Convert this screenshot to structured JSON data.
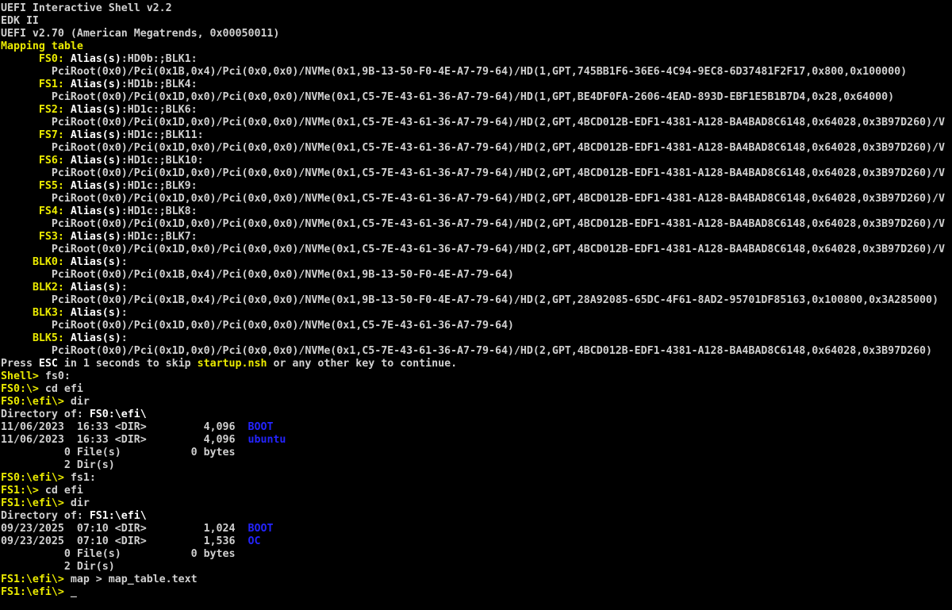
{
  "colors": {
    "background": "#000000",
    "gray": "#d0d0d0",
    "white": "#ffffff",
    "yellow": "#ebeb00",
    "blue": "#2424ff"
  },
  "terminal": {
    "lines": [
      {
        "name": "shell-version-line",
        "segments": [
          {
            "color": "gray",
            "text": "UEFI Interactive Shell v2.2"
          }
        ]
      },
      {
        "name": "edk-version-line",
        "segments": [
          {
            "color": "gray",
            "text": "EDK II"
          }
        ]
      },
      {
        "name": "firmware-version-line",
        "segments": [
          {
            "color": "gray",
            "text": "UEFI v2.70 (American Megatrends, 0x00050011)"
          }
        ]
      },
      {
        "name": "mapping-table-header",
        "segments": [
          {
            "color": "yellow",
            "text": "Mapping table"
          }
        ]
      },
      {
        "name": "map-entry-fs0",
        "segments": [
          {
            "color": "gray",
            "text": "      "
          },
          {
            "color": "yellow",
            "text": "FS0:"
          },
          {
            "color": "gray",
            "text": " "
          },
          {
            "color": "white",
            "text": "Alias(s)"
          },
          {
            "color": "gray",
            "text": ":HD0b:;BLK1:"
          }
        ]
      },
      {
        "name": "device-path-fs0",
        "segments": [
          {
            "color": "gray",
            "text": "        PciRoot(0x0)/Pci(0x1B,0x4)/Pci(0x0,0x0)/NVMe(0x1,9B-13-50-F0-4E-A7-79-64)/HD(1,GPT,745BB1F6-36E6-4C94-9EC8-6D37481F2F17,0x800,0x100000)"
          }
        ]
      },
      {
        "name": "map-entry-fs1",
        "segments": [
          {
            "color": "gray",
            "text": "      "
          },
          {
            "color": "yellow",
            "text": "FS1:"
          },
          {
            "color": "gray",
            "text": " "
          },
          {
            "color": "white",
            "text": "Alias(s)"
          },
          {
            "color": "gray",
            "text": ":HD1b:;BLK4:"
          }
        ]
      },
      {
        "name": "device-path-fs1",
        "segments": [
          {
            "color": "gray",
            "text": "        PciRoot(0x0)/Pci(0x1D,0x0)/Pci(0x0,0x0)/NVMe(0x1,C5-7E-43-61-36-A7-79-64)/HD(1,GPT,BE4DF0FA-2606-4EAD-893D-EBF1E5B1B7D4,0x28,0x64000)"
          }
        ]
      },
      {
        "name": "map-entry-fs2",
        "segments": [
          {
            "color": "gray",
            "text": "      "
          },
          {
            "color": "yellow",
            "text": "FS2:"
          },
          {
            "color": "gray",
            "text": " "
          },
          {
            "color": "white",
            "text": "Alias(s)"
          },
          {
            "color": "gray",
            "text": ":HD1c:;BLK6:"
          }
        ]
      },
      {
        "name": "device-path-fs2",
        "segments": [
          {
            "color": "gray",
            "text": "        PciRoot(0x0)/Pci(0x1D,0x0)/Pci(0x0,0x0)/NVMe(0x1,C5-7E-43-61-36-A7-79-64)/HD(2,GPT,4BCD012B-EDF1-4381-A128-BA4BAD8C6148,0x64028,0x3B97D260)/V"
          }
        ]
      },
      {
        "name": "map-entry-fs7",
        "segments": [
          {
            "color": "gray",
            "text": "      "
          },
          {
            "color": "yellow",
            "text": "FS7:"
          },
          {
            "color": "gray",
            "text": " "
          },
          {
            "color": "white",
            "text": "Alias(s)"
          },
          {
            "color": "gray",
            "text": ":HD1c:;BLK11:"
          }
        ]
      },
      {
        "name": "device-path-fs7",
        "segments": [
          {
            "color": "gray",
            "text": "        PciRoot(0x0)/Pci(0x1D,0x0)/Pci(0x0,0x0)/NVMe(0x1,C5-7E-43-61-36-A7-79-64)/HD(2,GPT,4BCD012B-EDF1-4381-A128-BA4BAD8C6148,0x64028,0x3B97D260)/V"
          }
        ]
      },
      {
        "name": "map-entry-fs6",
        "segments": [
          {
            "color": "gray",
            "text": "      "
          },
          {
            "color": "yellow",
            "text": "FS6:"
          },
          {
            "color": "gray",
            "text": " "
          },
          {
            "color": "white",
            "text": "Alias(s)"
          },
          {
            "color": "gray",
            "text": ":HD1c:;BLK10:"
          }
        ]
      },
      {
        "name": "device-path-fs6",
        "segments": [
          {
            "color": "gray",
            "text": "        PciRoot(0x0)/Pci(0x1D,0x0)/Pci(0x0,0x0)/NVMe(0x1,C5-7E-43-61-36-A7-79-64)/HD(2,GPT,4BCD012B-EDF1-4381-A128-BA4BAD8C6148,0x64028,0x3B97D260)/V"
          }
        ]
      },
      {
        "name": "map-entry-fs5",
        "segments": [
          {
            "color": "gray",
            "text": "      "
          },
          {
            "color": "yellow",
            "text": "FS5:"
          },
          {
            "color": "gray",
            "text": " "
          },
          {
            "color": "white",
            "text": "Alias(s)"
          },
          {
            "color": "gray",
            "text": ":HD1c:;BLK9:"
          }
        ]
      },
      {
        "name": "device-path-fs5",
        "segments": [
          {
            "color": "gray",
            "text": "        PciRoot(0x0)/Pci(0x1D,0x0)/Pci(0x0,0x0)/NVMe(0x1,C5-7E-43-61-36-A7-79-64)/HD(2,GPT,4BCD012B-EDF1-4381-A128-BA4BAD8C6148,0x64028,0x3B97D260)/V"
          }
        ]
      },
      {
        "name": "map-entry-fs4",
        "segments": [
          {
            "color": "gray",
            "text": "      "
          },
          {
            "color": "yellow",
            "text": "FS4:"
          },
          {
            "color": "gray",
            "text": " "
          },
          {
            "color": "white",
            "text": "Alias(s)"
          },
          {
            "color": "gray",
            "text": ":HD1c:;BLK8:"
          }
        ]
      },
      {
        "name": "device-path-fs4",
        "segments": [
          {
            "color": "gray",
            "text": "        PciRoot(0x0)/Pci(0x1D,0x0)/Pci(0x0,0x0)/NVMe(0x1,C5-7E-43-61-36-A7-79-64)/HD(2,GPT,4BCD012B-EDF1-4381-A128-BA4BAD8C6148,0x64028,0x3B97D260)/V"
          }
        ]
      },
      {
        "name": "map-entry-fs3",
        "segments": [
          {
            "color": "gray",
            "text": "      "
          },
          {
            "color": "yellow",
            "text": "FS3:"
          },
          {
            "color": "gray",
            "text": " "
          },
          {
            "color": "white",
            "text": "Alias(s)"
          },
          {
            "color": "gray",
            "text": ":HD1c:;BLK7:"
          }
        ]
      },
      {
        "name": "device-path-fs3",
        "segments": [
          {
            "color": "gray",
            "text": "        PciRoot(0x0)/Pci(0x1D,0x0)/Pci(0x0,0x0)/NVMe(0x1,C5-7E-43-61-36-A7-79-64)/HD(2,GPT,4BCD012B-EDF1-4381-A128-BA4BAD8C6148,0x64028,0x3B97D260)/V"
          }
        ]
      },
      {
        "name": "map-entry-blk0",
        "segments": [
          {
            "color": "gray",
            "text": "     "
          },
          {
            "color": "yellow",
            "text": "BLK0:"
          },
          {
            "color": "gray",
            "text": " "
          },
          {
            "color": "white",
            "text": "Alias(s)"
          },
          {
            "color": "gray",
            "text": ":"
          }
        ]
      },
      {
        "name": "device-path-blk0",
        "segments": [
          {
            "color": "gray",
            "text": "        PciRoot(0x0)/Pci(0x1B,0x4)/Pci(0x0,0x0)/NVMe(0x1,9B-13-50-F0-4E-A7-79-64)"
          }
        ]
      },
      {
        "name": "map-entry-blk2",
        "segments": [
          {
            "color": "gray",
            "text": "     "
          },
          {
            "color": "yellow",
            "text": "BLK2:"
          },
          {
            "color": "gray",
            "text": " "
          },
          {
            "color": "white",
            "text": "Alias(s)"
          },
          {
            "color": "gray",
            "text": ":"
          }
        ]
      },
      {
        "name": "device-path-blk2",
        "segments": [
          {
            "color": "gray",
            "text": "        PciRoot(0x0)/Pci(0x1B,0x4)/Pci(0x0,0x0)/NVMe(0x1,9B-13-50-F0-4E-A7-79-64)/HD(2,GPT,28A92085-65DC-4F61-8AD2-95701DF85163,0x100800,0x3A285000)"
          }
        ]
      },
      {
        "name": "map-entry-blk3",
        "segments": [
          {
            "color": "gray",
            "text": "     "
          },
          {
            "color": "yellow",
            "text": "BLK3:"
          },
          {
            "color": "gray",
            "text": " "
          },
          {
            "color": "white",
            "text": "Alias(s)"
          },
          {
            "color": "gray",
            "text": ":"
          }
        ]
      },
      {
        "name": "device-path-blk3",
        "segments": [
          {
            "color": "gray",
            "text": "        PciRoot(0x0)/Pci(0x1D,0x0)/Pci(0x0,0x0)/NVMe(0x1,C5-7E-43-61-36-A7-79-64)"
          }
        ]
      },
      {
        "name": "map-entry-blk5",
        "segments": [
          {
            "color": "gray",
            "text": "     "
          },
          {
            "color": "yellow",
            "text": "BLK5:"
          },
          {
            "color": "gray",
            "text": " "
          },
          {
            "color": "white",
            "text": "Alias(s)"
          },
          {
            "color": "gray",
            "text": ":"
          }
        ]
      },
      {
        "name": "device-path-blk5",
        "segments": [
          {
            "color": "gray",
            "text": "        PciRoot(0x0)/Pci(0x1D,0x0)/Pci(0x0,0x0)/NVMe(0x1,C5-7E-43-61-36-A7-79-64)/HD(2,GPT,4BCD012B-EDF1-4381-A128-BA4BAD8C6148,0x64028,0x3B97D260)"
          }
        ]
      },
      {
        "name": "startup-skip-message",
        "segments": [
          {
            "color": "gray",
            "text": "Press "
          },
          {
            "color": "white",
            "text": "ESC"
          },
          {
            "color": "gray",
            "text": " in 1 seconds to skip "
          },
          {
            "color": "yellow",
            "text": "startup.nsh"
          },
          {
            "color": "gray",
            "text": " or any other key to continue."
          }
        ]
      },
      {
        "name": "prompt-shell",
        "segments": [
          {
            "color": "yellow",
            "text": "Shell> "
          },
          {
            "color": "gray",
            "text": "fs0:"
          }
        ]
      },
      {
        "name": "prompt-fs0-root",
        "segments": [
          {
            "color": "yellow",
            "text": "FS0:\\> "
          },
          {
            "color": "gray",
            "text": "cd efi"
          }
        ]
      },
      {
        "name": "prompt-fs0-efi",
        "segments": [
          {
            "color": "yellow",
            "text": "FS0:\\efi\\> "
          },
          {
            "color": "gray",
            "text": "dir"
          }
        ]
      },
      {
        "name": "directory-of-fs0",
        "segments": [
          {
            "color": "gray",
            "text": "Directory of: "
          },
          {
            "color": "white",
            "text": "FS0:\\efi\\"
          }
        ]
      },
      {
        "name": "dir-row-boot-fs0",
        "segments": [
          {
            "color": "gray",
            "text": "11/06/2023  16:33 <DIR>         4,096  "
          },
          {
            "color": "blue",
            "text": "BOOT"
          }
        ]
      },
      {
        "name": "dir-row-ubuntu",
        "segments": [
          {
            "color": "gray",
            "text": "11/06/2023  16:33 <DIR>         4,096  "
          },
          {
            "color": "blue",
            "text": "ubuntu"
          }
        ]
      },
      {
        "name": "file-summary-fs0",
        "segments": [
          {
            "color": "gray",
            "text": "          0 File(s)           0 bytes"
          }
        ]
      },
      {
        "name": "dir-summary-fs0",
        "segments": [
          {
            "color": "gray",
            "text": "          2 Dir(s)"
          }
        ]
      },
      {
        "name": "prompt-fs0-to-fs1",
        "segments": [
          {
            "color": "yellow",
            "text": "FS0:\\efi\\> "
          },
          {
            "color": "gray",
            "text": "fs1:"
          }
        ]
      },
      {
        "name": "prompt-fs1-root",
        "segments": [
          {
            "color": "yellow",
            "text": "FS1:\\> "
          },
          {
            "color": "gray",
            "text": "cd efi"
          }
        ]
      },
      {
        "name": "prompt-fs1-efi",
        "segments": [
          {
            "color": "yellow",
            "text": "FS1:\\efi\\> "
          },
          {
            "color": "gray",
            "text": "dir"
          }
        ]
      },
      {
        "name": "directory-of-fs1",
        "segments": [
          {
            "color": "gray",
            "text": "Directory of: "
          },
          {
            "color": "white",
            "text": "FS1:\\efi\\"
          }
        ]
      },
      {
        "name": "dir-row-boot-fs1",
        "segments": [
          {
            "color": "gray",
            "text": "09/23/2025  07:10 <DIR>         1,024  "
          },
          {
            "color": "blue",
            "text": "BOOT"
          }
        ]
      },
      {
        "name": "dir-row-oc",
        "segments": [
          {
            "color": "gray",
            "text": "09/23/2025  07:10 <DIR>         1,536  "
          },
          {
            "color": "blue",
            "text": "OC"
          }
        ]
      },
      {
        "name": "file-summary-fs1",
        "segments": [
          {
            "color": "gray",
            "text": "          0 File(s)           0 bytes"
          }
        ]
      },
      {
        "name": "dir-summary-fs1",
        "segments": [
          {
            "color": "gray",
            "text": "          2 Dir(s)"
          }
        ]
      },
      {
        "name": "prompt-map-command",
        "segments": [
          {
            "color": "yellow",
            "text": "FS1:\\efi\\> "
          },
          {
            "color": "gray",
            "text": "map > map_table.text"
          }
        ]
      },
      {
        "name": "prompt-current",
        "segments": [
          {
            "color": "yellow",
            "text": "FS1:\\efi\\> "
          },
          {
            "color": "gray",
            "text": "",
            "name": "cursor",
            "cursor": true,
            "cursor_text": "_"
          }
        ]
      }
    ]
  }
}
